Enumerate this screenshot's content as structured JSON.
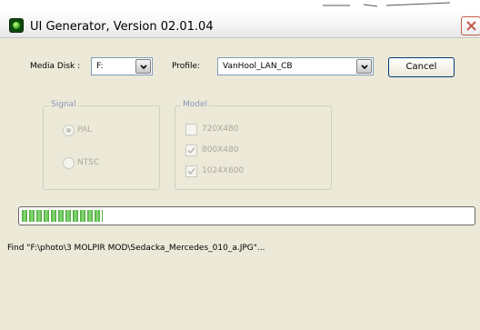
{
  "window": {
    "title": "UI Generator, Version 02.01.04"
  },
  "form": {
    "media_disk_label": "Media Disk :",
    "media_disk_value": "F:",
    "profile_label": "Profile:",
    "profile_value": "VanHool_LAN_CB",
    "cancel_label": "Cancel"
  },
  "signal": {
    "title": "Signal",
    "options": [
      {
        "label": "PAL",
        "selected": true
      },
      {
        "label": "NTSC",
        "selected": false
      }
    ]
  },
  "model": {
    "title": "Model",
    "options": [
      {
        "label": "720X480",
        "checked": false
      },
      {
        "label": "800X480",
        "checked": true
      },
      {
        "label": "1024X600",
        "checked": true
      }
    ]
  },
  "progress": {
    "fraction": 0.18
  },
  "status": {
    "text": "Find \"F:\\photo\\3 MOLPIR MOD\\Sedacka_Mercedes_010_a.JPG\"..."
  },
  "colors": {
    "window_bg": "#ece9d8",
    "progress_green": "#4aa43a",
    "close_red": "#c25a4a",
    "disabled_text": "#aca899"
  },
  "icons": {
    "app": "app-icon",
    "close": "close-icon",
    "dropdown": "chevron-down-icon",
    "check": "check-icon"
  }
}
